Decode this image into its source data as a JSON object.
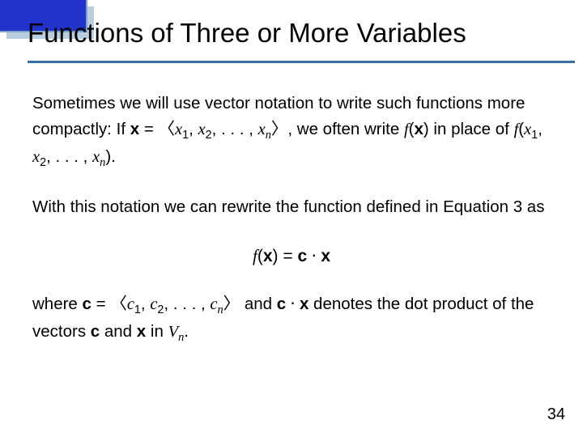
{
  "slide": {
    "title": "Functions of Three or More Variables",
    "page_number": "34"
  },
  "p1": {
    "t1": "Sometimes we will use vector notation to write such functions more compactly: If ",
    "xbold": "x",
    "eq": " = ",
    "lang": "〈",
    "x1": "x",
    "s1": "1",
    "c1": ", ",
    "x2": "x",
    "s2": "2",
    "c2": ", . . . , ",
    "xn": "x",
    "sn": "n",
    "rang": "〉",
    "t2": ", we often write ",
    "f1": "f",
    "lp1": "(",
    "xb2": "x",
    "rp1": ")",
    "t3": " in place of ",
    "f2": "f",
    "lp2": "(",
    "xa": "x",
    "sa": "1",
    "ca": ", ",
    "xb": "x",
    "sb": "2",
    "cb": ", . . . , ",
    "xc": "x",
    "sc": "n",
    "rp2": ")."
  },
  "p2": {
    "t1": "With this notation we can rewrite the function defined in Equation 3 as"
  },
  "eq": {
    "f": "f",
    "lp": "(",
    "x": "x",
    "rp": ")",
    "eq": " = ",
    "c": "c",
    "dot": " ⋅ ",
    "x2": "x"
  },
  "p3": {
    "t1": "where ",
    "c": "c",
    "eq": " = ",
    "lang": "〈",
    "c1": "c",
    "s1": "1",
    "cm1": ", ",
    "c2": "c",
    "s2": "2",
    "cm2": ", . . . , ",
    "cn": "c",
    "sn": "n",
    "rang": "〉",
    "t2": " and ",
    "cB": "c",
    "dot": " ⋅ ",
    "xB": "x",
    "t3": " denotes the dot product of the vectors ",
    "cC": "c",
    "t4": " and ",
    "xC": "x",
    "t5": " in ",
    "V": "V",
    "vn": "n",
    "t6": "."
  }
}
